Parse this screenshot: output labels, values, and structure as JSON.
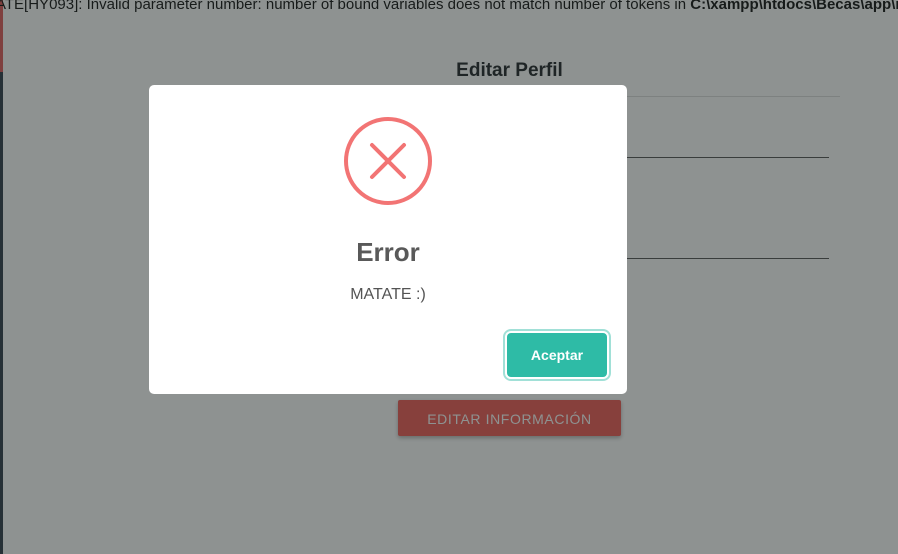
{
  "php_error": {
    "prefix": "ATE[HY093]: Invalid parameter number: number of bound variables does not match number of tokens in ",
    "path": "C:\\xampp\\htdocs\\Becas\\app\\m"
  },
  "profile_card": {
    "title": "Editar Perfil",
    "edit_button_label": "EDITAR INFORMACIÓN"
  },
  "modal": {
    "icon": "error-x-icon",
    "title": "Error",
    "message": "MATATE :)",
    "confirm_label": "Aceptar"
  },
  "colors": {
    "error_icon": "#f27474",
    "confirm_button": "#2ebba6",
    "edit_button": "#f05a55"
  }
}
